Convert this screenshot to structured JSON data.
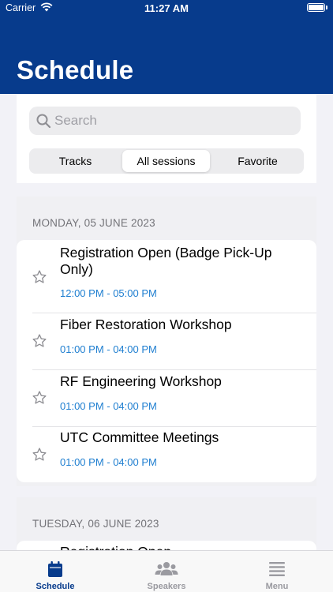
{
  "status_bar": {
    "carrier": "Carrier",
    "time": "11:27 AM"
  },
  "header": {
    "title": "Schedule"
  },
  "search": {
    "placeholder": "Search",
    "value": ""
  },
  "segments": [
    {
      "label": "Tracks"
    },
    {
      "label": "All sessions",
      "selected": true
    },
    {
      "label": "Favorite"
    }
  ],
  "days": [
    {
      "label": "MONDAY, 05 JUNE 2023",
      "sessions": [
        {
          "title": "Registration Open (Badge Pick-Up Only)",
          "time": "12:00 PM - 05:00 PM"
        },
        {
          "title": "Fiber Restoration Workshop",
          "time": "01:00 PM - 04:00 PM"
        },
        {
          "title": "RF Engineering Workshop",
          "time": "01:00 PM - 04:00 PM"
        },
        {
          "title": "UTC Committee Meetings",
          "time": "01:00 PM - 04:00 PM"
        }
      ]
    },
    {
      "label": "TUESDAY, 06 JUNE 2023",
      "sessions": [
        {
          "title": "Registration Open",
          "time": ""
        }
      ]
    }
  ],
  "tabs": [
    {
      "label": "Schedule",
      "icon": "calendar-icon",
      "active": true
    },
    {
      "label": "Speakers",
      "icon": "people-icon",
      "active": false
    },
    {
      "label": "Menu",
      "icon": "menu-icon",
      "active": false
    }
  ],
  "colors": {
    "header": "#073b8c",
    "accent_time": "#1e7ed0",
    "inactive_tab": "#9a9aa0"
  }
}
